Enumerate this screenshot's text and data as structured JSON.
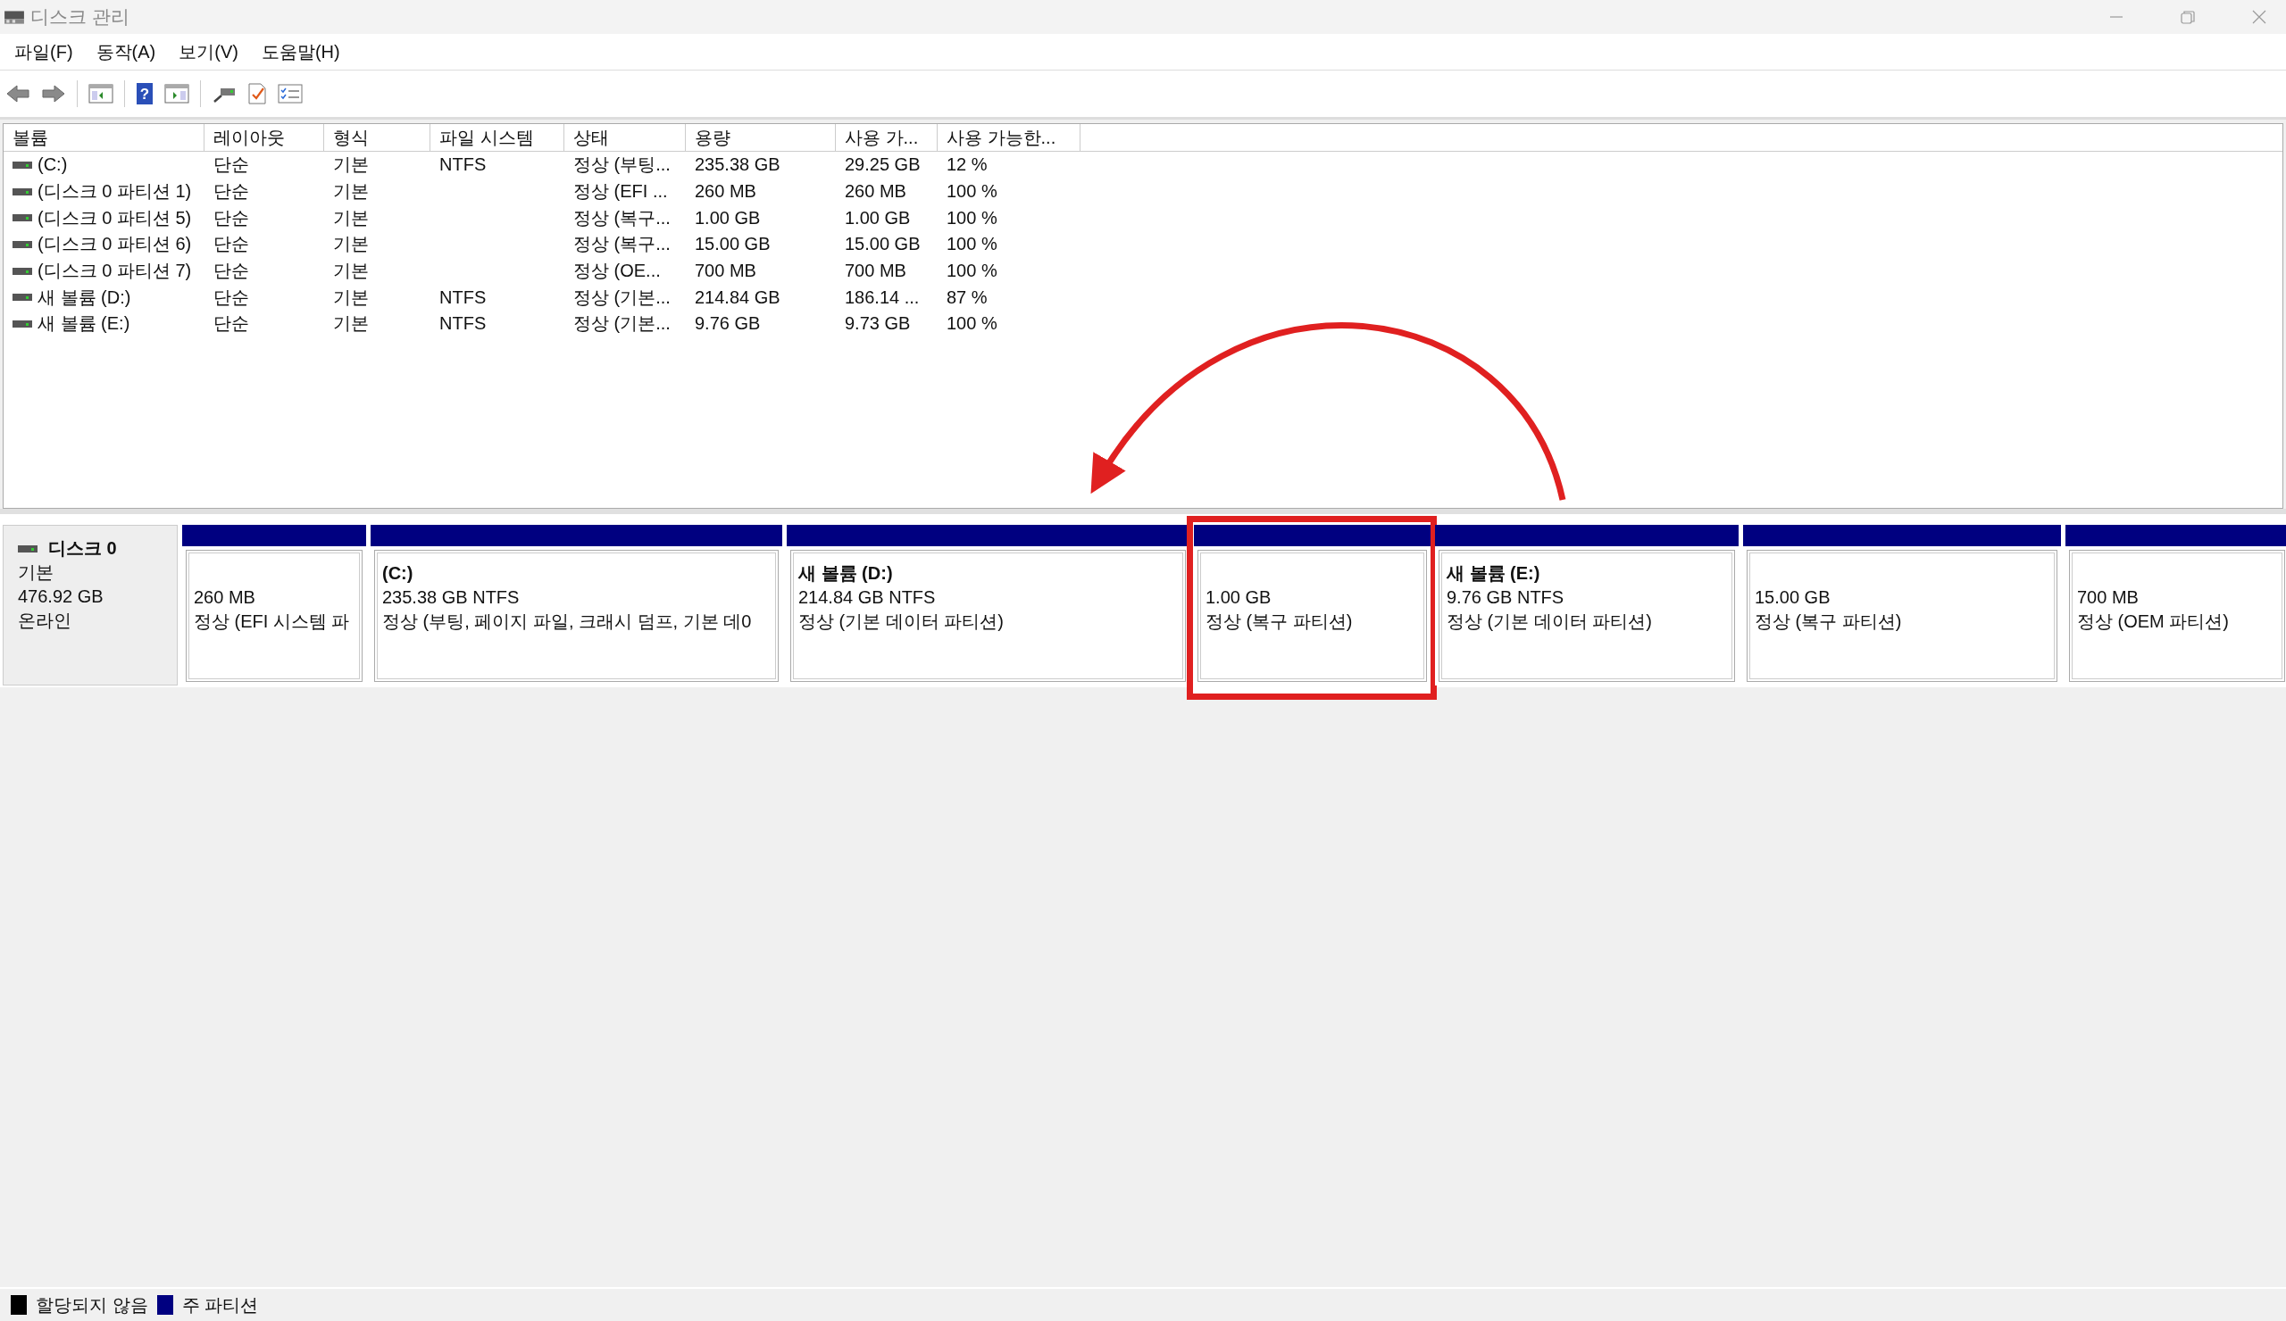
{
  "window": {
    "title": "디스크 관리"
  },
  "toolbar": {
    "help_glyph": "?"
  },
  "menu": [
    "파일(F)",
    "동작(A)",
    "보기(V)",
    "도움말(H)"
  ],
  "table": {
    "columns": [
      "볼륨",
      "레이아웃",
      "형식",
      "파일 시스템",
      "상태",
      "용량",
      "사용 가...",
      "사용 가능한..."
    ],
    "rows": [
      [
        "(C:)",
        "단순",
        "기본",
        "NTFS",
        "정상 (부팅...",
        "235.38 GB",
        "29.25 GB",
        "12 %"
      ],
      [
        "(디스크 0 파티션 1)",
        "단순",
        "기본",
        "",
        "정상 (EFI ...",
        "260 MB",
        "260 MB",
        "100 %"
      ],
      [
        "(디스크 0 파티션 5)",
        "단순",
        "기본",
        "",
        "정상 (복구...",
        "1.00 GB",
        "1.00 GB",
        "100 %"
      ],
      [
        "(디스크 0 파티션 6)",
        "단순",
        "기본",
        "",
        "정상 (복구...",
        "15.00 GB",
        "15.00 GB",
        "100 %"
      ],
      [
        "(디스크 0 파티션 7)",
        "단순",
        "기본",
        "",
        "정상 (OE...",
        "700 MB",
        "700 MB",
        "100 %"
      ],
      [
        "새 볼륨 (D:)",
        "단순",
        "기본",
        "NTFS",
        "정상 (기본...",
        "214.84 GB",
        "186.14 ...",
        "87 %"
      ],
      [
        "새 볼륨 (E:)",
        "단순",
        "기본",
        "NTFS",
        "정상 (기본...",
        "9.76 GB",
        "9.73 GB",
        "100 %"
      ]
    ]
  },
  "disk": {
    "name": "디스크 0",
    "type": "기본",
    "size": "476.92 GB",
    "status": "온라인",
    "partitions": [
      {
        "size": "260 MB",
        "status": "정상 (EFI 시스템 파",
        "highlighted": false
      },
      {
        "name": "(C:)",
        "size": "235.38 GB NTFS",
        "status": "정상 (부팅, 페이지 파일, 크래시 덤프, 기본 데0",
        "highlighted": false
      },
      {
        "name": "새 볼륨  (D:)",
        "size": "214.84 GB NTFS",
        "status": "정상 (기본 데이터 파티션)",
        "highlighted": false
      },
      {
        "size": "1.00 GB",
        "status": "정상 (복구 파티션)",
        "highlighted": true
      },
      {
        "name": "새 볼륨  (E:)",
        "size": "9.76 GB NTFS",
        "status": "정상 (기본 데이터 파티션)",
        "highlighted": false
      },
      {
        "size": "15.00 GB",
        "status": "정상 (복구 파티션)",
        "highlighted": false
      },
      {
        "size": "700 MB",
        "status": "정상 (OEM 파티션)",
        "highlighted": false
      }
    ]
  },
  "legend": [
    {
      "label": "할당되지 않음",
      "color": "#000000"
    },
    {
      "label": "주 파티션",
      "color": "#000080"
    }
  ]
}
